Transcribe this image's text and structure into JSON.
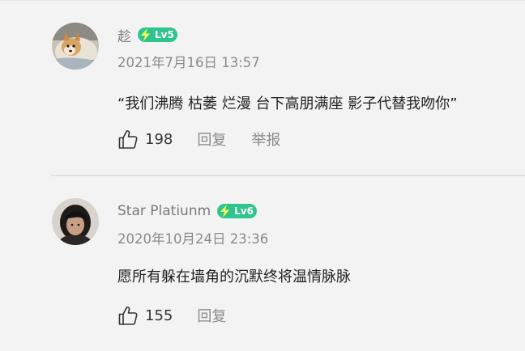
{
  "comments": [
    {
      "username": "趁",
      "level": "Lv5",
      "timestamp": "2021年7月16日 13:57",
      "text": "“我们沸腾 枯萎 烂漫 台下高朋满座 影子代替我吻你”",
      "likes": "198",
      "reply_label": "回复",
      "report_label": "举报"
    },
    {
      "username": "Star Platiunm",
      "level": "Lv6",
      "timestamp": "2020年10月24日 23:36",
      "text": "愿所有躲在墙角的沉默终将温情脉脉",
      "likes": "155",
      "reply_label": "回复"
    }
  ],
  "colors": {
    "background": "#f3f3f3",
    "level_badge": "#2dc58c",
    "secondary_text": "#8a8a8a"
  },
  "icons": [
    "like-thumb-icon",
    "lightning-icon"
  ]
}
